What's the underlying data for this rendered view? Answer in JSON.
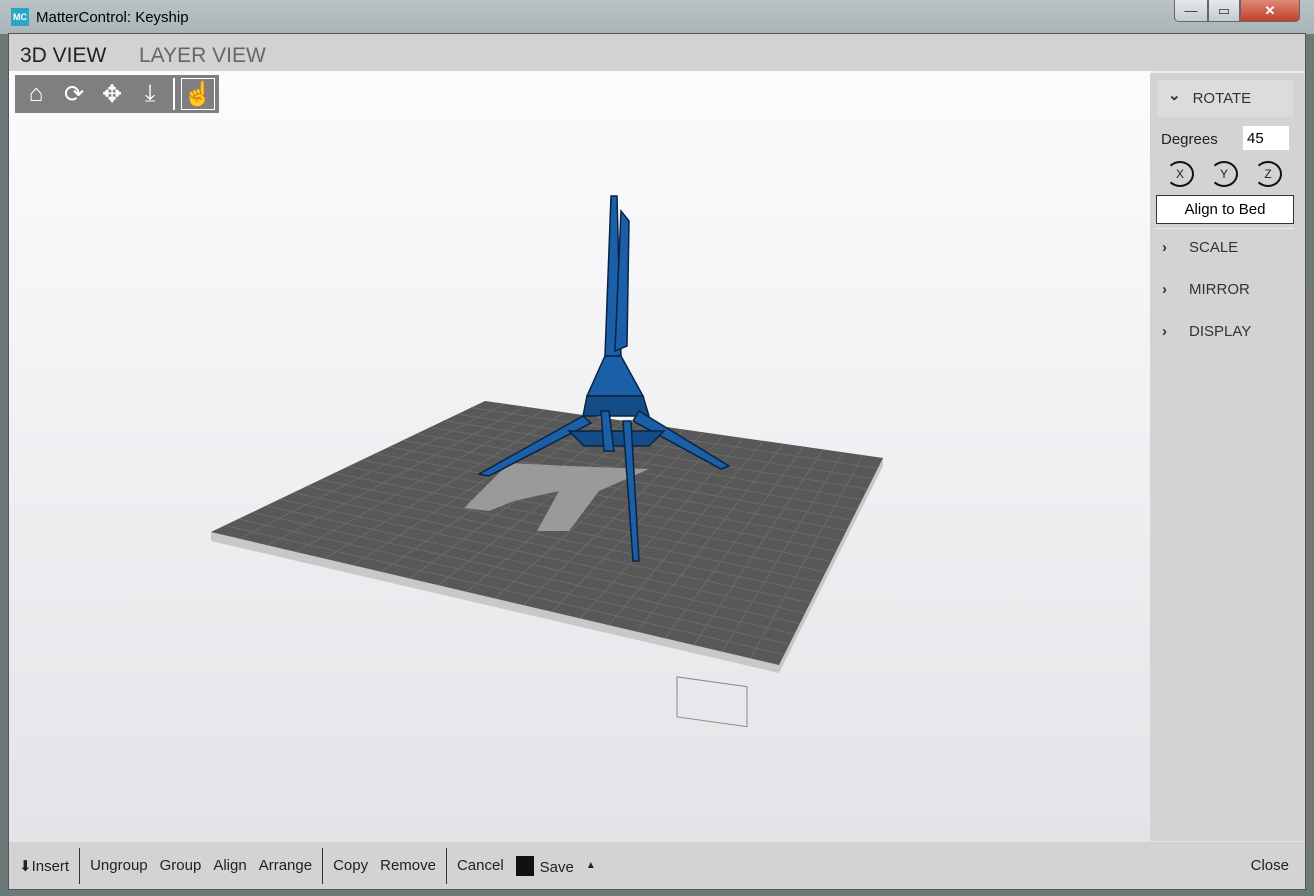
{
  "window": {
    "title": "MatterControl: Keyship",
    "icon_text": "MC",
    "minimize": "—",
    "maximize": "▭",
    "close": "✕"
  },
  "tabs": [
    {
      "label": "3D VIEW",
      "active": true
    },
    {
      "label": "LAYER VIEW",
      "active": false
    }
  ],
  "toolbar": {
    "icons": [
      "home-icon",
      "rotate-icon",
      "move-icon",
      "zoom-icon",
      "select-icon"
    ],
    "glyphs": [
      "⌂",
      "⟳",
      "✥",
      "⤓",
      "☝"
    ]
  },
  "panel": {
    "rotate": {
      "title": "ROTATE",
      "chevron": "⌄",
      "degrees_label": "Degrees",
      "degrees_value": "45",
      "axes": [
        "X",
        "Y",
        "Z"
      ],
      "align_button": "Align to Bed"
    },
    "sections": [
      {
        "title": "SCALE"
      },
      {
        "title": "MIRROR"
      },
      {
        "title": "DISPLAY"
      }
    ],
    "chevron_right": "›"
  },
  "bottombar": {
    "insert": "Insert",
    "ungroup": "Ungroup",
    "group": "Group",
    "align": "Align",
    "arrange": "Arrange",
    "copy": "Copy",
    "remove": "Remove",
    "cancel": "Cancel",
    "save": "Save",
    "save_menu": "▲",
    "close": "Close"
  },
  "colors": {
    "model": "#1a5fa8",
    "bed": "#585858",
    "accent": "#2aa7c4"
  }
}
